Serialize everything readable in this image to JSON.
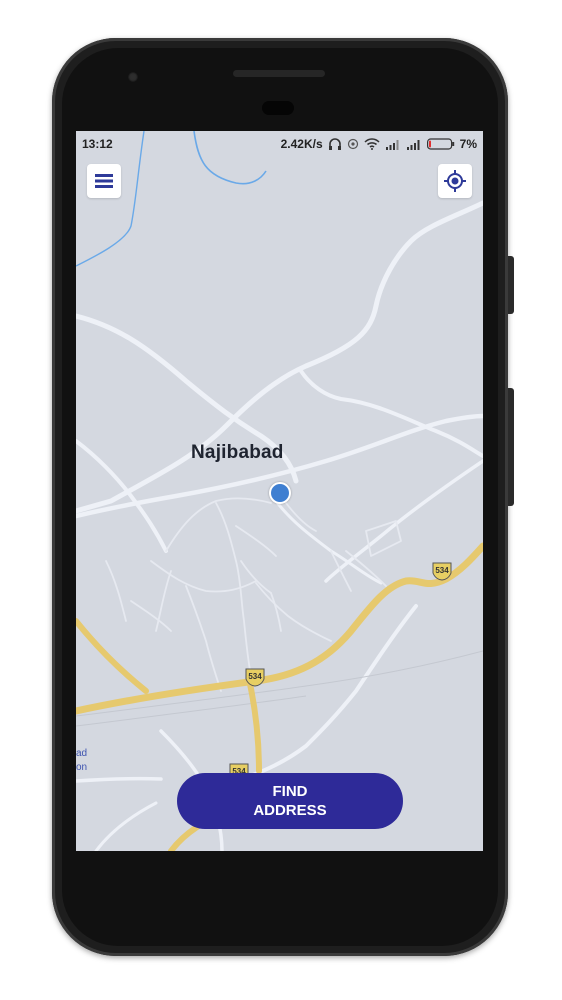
{
  "status_bar": {
    "time": "13:12",
    "network_speed": "2.42K/s",
    "battery_percent": "7%",
    "battery_level": 0.07
  },
  "map": {
    "place_label": "Najibabad",
    "highway_number": "534",
    "partial_label_line1": "ad",
    "partial_label_line2": "on",
    "colors": {
      "background": "#d4d8e0",
      "road": "#eef1f7",
      "highway": "#e6c96e",
      "water": "#6aa9e8",
      "user_location": "#3f7fd1"
    }
  },
  "buttons": {
    "menu_icon": "hamburger-menu-icon",
    "locate_icon": "my-location-icon",
    "find_address_line1": "FIND",
    "find_address_line2": "ADDRESS",
    "accent": "#2e2a98"
  }
}
